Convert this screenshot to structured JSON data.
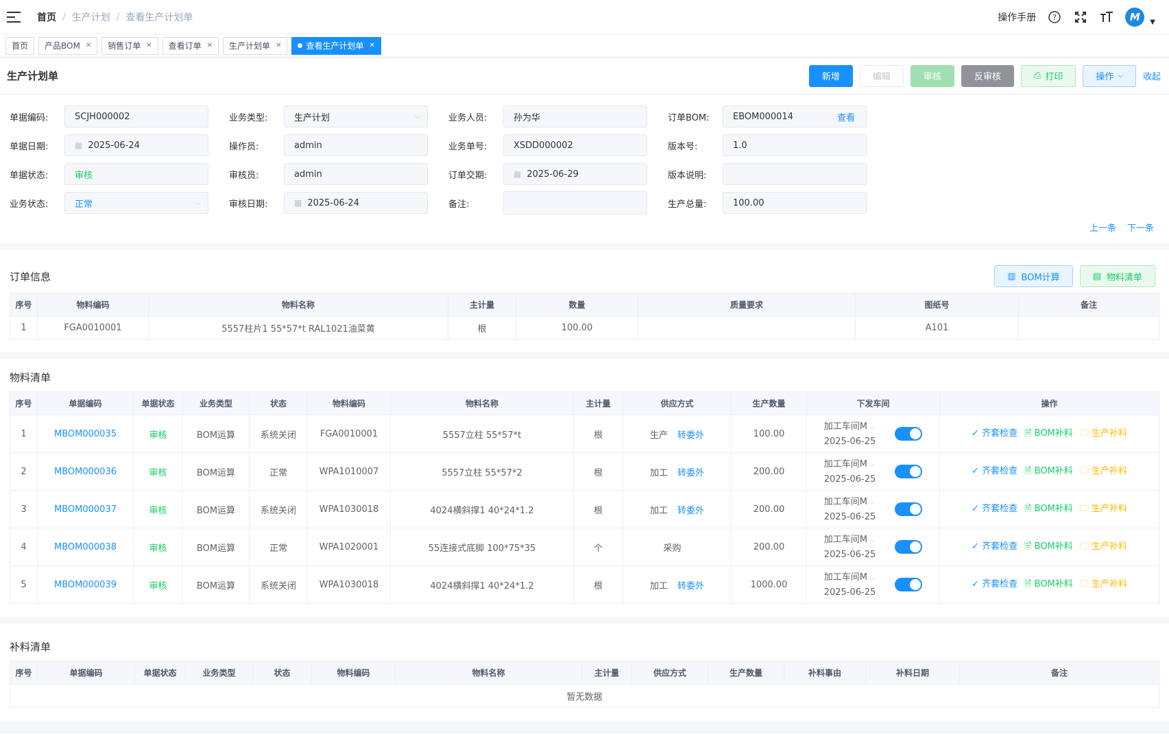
{
  "breadcrumb": [
    "首页",
    "生产计划",
    "查看生产计划单"
  ],
  "header": {
    "manual": "操作手册",
    "avatar": "M"
  },
  "tags": [
    {
      "label": "首页"
    },
    {
      "label": "产品BOM"
    },
    {
      "label": "销售订单"
    },
    {
      "label": "查看订单"
    },
    {
      "label": "生产计划单"
    },
    {
      "label": "查看生产计划单"
    }
  ],
  "form_card": {
    "title": "生产计划单",
    "buttons": {
      "add": "新增",
      "edit": "编辑",
      "audit": "审核",
      "unaudit": "反审核",
      "print": "打印",
      "ops": "操作",
      "collapse": "收起"
    },
    "fields": {
      "doc_no": {
        "label": "单据编码:",
        "value": "SCJH000002"
      },
      "biz_type": {
        "label": "业务类型:",
        "value": "生产计划"
      },
      "salesman": {
        "label": "业务人员:",
        "value": "孙为华"
      },
      "order_bom": {
        "label": "订单BOM:",
        "value": "EBOM000014",
        "link": "查看"
      },
      "doc_date": {
        "label": "单据日期:",
        "value": "2025-06-24"
      },
      "operator": {
        "label": "操作员:",
        "value": "admin"
      },
      "biz_no": {
        "label": "业务单号:",
        "value": "XSDD000002"
      },
      "version": {
        "label": "版本号:",
        "value": "1.0"
      },
      "doc_status": {
        "label": "单据状态:",
        "value": "审核"
      },
      "auditor": {
        "label": "审核员:",
        "value": "admin"
      },
      "delivery": {
        "label": "订单交期:",
        "value": "2025-06-29"
      },
      "version_desc": {
        "label": "版本说明:",
        "value": ""
      },
      "biz_status": {
        "label": "业务状态:",
        "value": "正常"
      },
      "audit_date": {
        "label": "审核日期:",
        "value": "2025-06-24"
      },
      "remark": {
        "label": "备注:",
        "value": ""
      },
      "total": {
        "label": "生产总量:",
        "value": "100.00"
      }
    },
    "prev": "上一条",
    "next": "下一条"
  },
  "order_info": {
    "title": "订单信息",
    "bom_btn": "BOM计算",
    "list_btn": "物料清单",
    "columns": [
      "序号",
      "物料编码",
      "物料名称",
      "主计量",
      "数量",
      "质量要求",
      "图纸号",
      "备注"
    ],
    "rows": [
      [
        "1",
        "FGA0010001",
        "5557柱片1 55*57*t RAL1021油菜黄",
        "根",
        "100.00",
        "",
        "A101",
        ""
      ]
    ]
  },
  "material": {
    "title": "物料清单",
    "columns": [
      "序号",
      "单据编码",
      "单据状态",
      "业务类型",
      "状态",
      "物料编码",
      "物料名称",
      "主计量",
      "供应方式",
      "生产数量",
      "下发车间",
      "操作"
    ],
    "ops": {
      "check": "齐套检查",
      "bom": "BOM补料",
      "prod": "生产补料"
    },
    "rows": [
      {
        "no": "1",
        "code": "MBOM000035",
        "doc_status": "审核",
        "biz": "BOM运算",
        "status": "系统关闭",
        "mat": "FGA0010001",
        "name": "5557立柱 55*57*t",
        "unit": "根",
        "supply": "生产",
        "outsource": "转委外",
        "qty": "100.00",
        "shop": "加工车间M",
        "date": "2025-06-25"
      },
      {
        "no": "2",
        "code": "MBOM000036",
        "doc_status": "审核",
        "biz": "BOM运算",
        "status": "正常",
        "mat": "WPA1010007",
        "name": "5557立柱 55*57*2",
        "unit": "根",
        "supply": "加工",
        "outsource": "转委外",
        "qty": "200.00",
        "shop": "加工车间M",
        "date": "2025-06-25"
      },
      {
        "no": "3",
        "code": "MBOM000037",
        "doc_status": "审核",
        "biz": "BOM运算",
        "status": "系统关闭",
        "mat": "WPA1030018",
        "name": "4024横斜撑1 40*24*1.2",
        "unit": "根",
        "supply": "加工",
        "outsource": "转委外",
        "qty": "200.00",
        "shop": "加工车间M",
        "date": "2025-06-25"
      },
      {
        "no": "4",
        "code": "MBOM000038",
        "doc_status": "审核",
        "biz": "BOM运算",
        "status": "正常",
        "mat": "WPA1020001",
        "name": "55连接式底脚 100*75*35",
        "unit": "个",
        "supply": "采购",
        "outsource": "",
        "qty": "200.00",
        "shop": "加工车间M",
        "date": "2025-06-25"
      },
      {
        "no": "5",
        "code": "MBOM000039",
        "doc_status": "审核",
        "biz": "BOM运算",
        "status": "系统关闭",
        "mat": "WPA1030018",
        "name": "4024横斜撑1 40*24*1.2",
        "unit": "根",
        "supply": "加工",
        "outsource": "转委外",
        "qty": "1000.00",
        "shop": "加工车间M",
        "date": "2025-06-25"
      }
    ]
  },
  "supplement": {
    "title": "补料清单",
    "columns": [
      "序号",
      "单据编码",
      "单据状态",
      "业务类型",
      "状态",
      "物料编码",
      "物料名称",
      "主计量",
      "供应方式",
      "生产数量",
      "补料事由",
      "补料日期",
      "备注"
    ],
    "empty": "暂无数据"
  }
}
